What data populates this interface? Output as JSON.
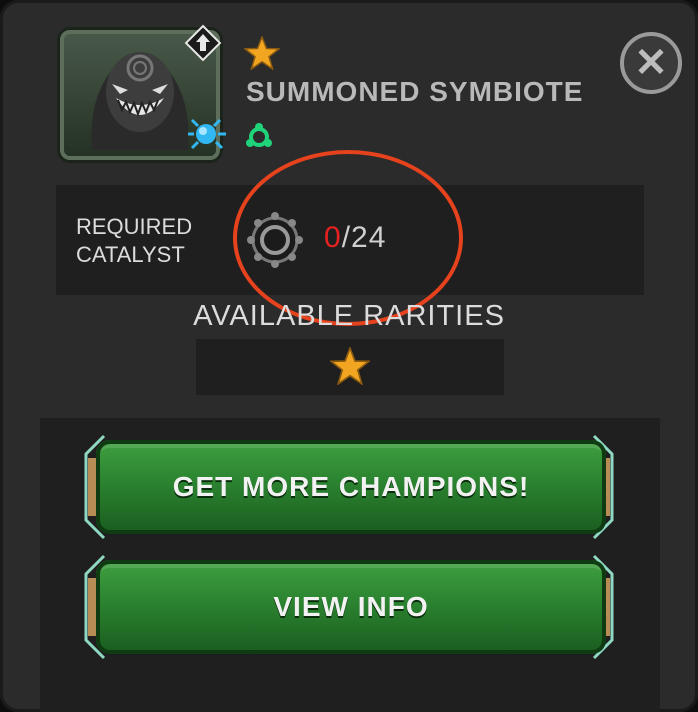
{
  "champion": {
    "name": "SUMMONED SYMBIOTE",
    "stars": 1,
    "portrait_icon": "symbiote-portrait",
    "class_icon": "cosmic-class-icon",
    "upgrade_icon": "upgrade-arrow-icon",
    "synergy_icon": "synergy-icon"
  },
  "close_icon": "close-icon",
  "catalyst": {
    "label": "REQUIRED\nCATALYST",
    "icon": "catalyst-icon",
    "have": "0",
    "separator": "/",
    "need": "24"
  },
  "rarities": {
    "label": "AVAILABLE RARITIES",
    "stars": 1
  },
  "buttons": {
    "get_more": "GET MORE CHAMPIONS!",
    "view_info": "VIEW INFO"
  },
  "colors": {
    "panel": "#2b2b2b",
    "highlight_oval": "#e5421d",
    "button_green": "#2b8330",
    "star": "#f2a521",
    "catalyst_have": "#e52121"
  }
}
